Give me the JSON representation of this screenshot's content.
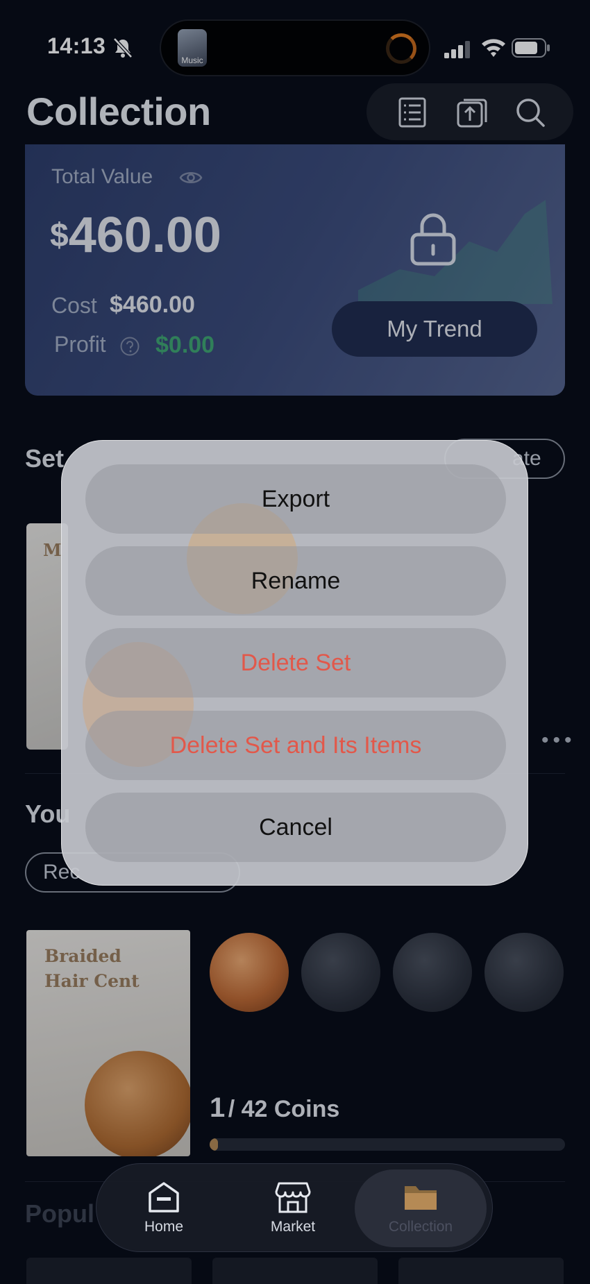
{
  "status_bar": {
    "time": "14:13",
    "live_activity_label": "Music"
  },
  "header": {
    "title": "Collection"
  },
  "value_card": {
    "total_value_label": "Total Value",
    "currency_symbol": "$",
    "total_value": "460.00",
    "cost_label": "Cost",
    "cost_value": "$460.00",
    "profit_label": "Profit",
    "profit_value": "$0.00",
    "trend_button": "My Trend"
  },
  "sets_section": {
    "title_partial": "Set",
    "action_partial": "ate",
    "thumb_partial": "M"
  },
  "your_section": {
    "title_partial": "You",
    "filter_partial": "Rec"
  },
  "sample_set": {
    "title_line1": "Braided",
    "title_line2": "Hair Cent",
    "owned": "1",
    "total_label": "/ 42 Coins",
    "progress_fraction": 0.024
  },
  "popular_section": {
    "title_partial": "Popul"
  },
  "action_sheet": {
    "export": "Export",
    "rename": "Rename",
    "delete_set": "Delete Set",
    "delete_set_items": "Delete Set and Its Items",
    "cancel": "Cancel"
  },
  "tab_bar": {
    "home": "Home",
    "market": "Market",
    "collection": "Collection"
  },
  "colors": {
    "destructive": "#e2584a",
    "profit": "#3fa772",
    "accent_bronze": "#b58a55"
  }
}
